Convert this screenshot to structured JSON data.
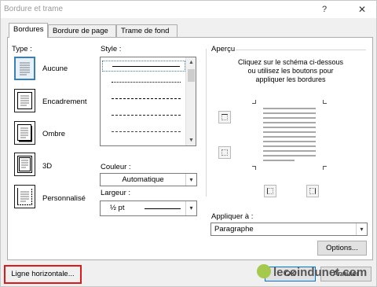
{
  "window": {
    "title": "Bordure et trame",
    "help": "?",
    "close": "✕"
  },
  "tabs": [
    {
      "label": "Bordures",
      "active": true
    },
    {
      "label": "Bordure de page",
      "active": false
    },
    {
      "label": "Trame de fond",
      "active": false
    }
  ],
  "type_section": {
    "label": "Type :",
    "items": [
      {
        "label": "Aucune",
        "icon": "border-none-icon",
        "selected": true
      },
      {
        "label": "Encadrement",
        "icon": "border-box-icon",
        "selected": false
      },
      {
        "label": "Ombre",
        "icon": "border-shadow-icon",
        "selected": false
      },
      {
        "label": "3D",
        "icon": "border-3d-icon",
        "selected": false
      },
      {
        "label": "Personnalisé",
        "icon": "border-custom-icon",
        "selected": false
      }
    ]
  },
  "style_section": {
    "label": "Style :",
    "items": [
      {
        "style": "solid",
        "selected": true
      },
      {
        "style": "dotted",
        "selected": false
      },
      {
        "style": "dashed-small",
        "selected": false
      },
      {
        "style": "dashed-medium",
        "selected": false
      },
      {
        "style": "dashed-large",
        "selected": false
      }
    ]
  },
  "color": {
    "label": "Couleur :",
    "value": "Automatique"
  },
  "width": {
    "label": "Largeur :",
    "value": "½ pt"
  },
  "preview": {
    "label": "Aperçu",
    "instructions": [
      "Cliquez sur le schéma ci-dessous",
      "ou utilisez les boutons pour",
      "appliquer les bordures"
    ]
  },
  "apply": {
    "label": "Appliquer à :",
    "value": "Paragraphe"
  },
  "buttons": {
    "options": "Options...",
    "horizontal_line": "Ligne horizontale...",
    "ok": "OK",
    "cancel": "Annuler"
  },
  "watermark": "lecoindunet.com",
  "colors": {
    "accent": "#3c7fb1",
    "highlight": "#e01818",
    "default_button": "#0078d7"
  }
}
